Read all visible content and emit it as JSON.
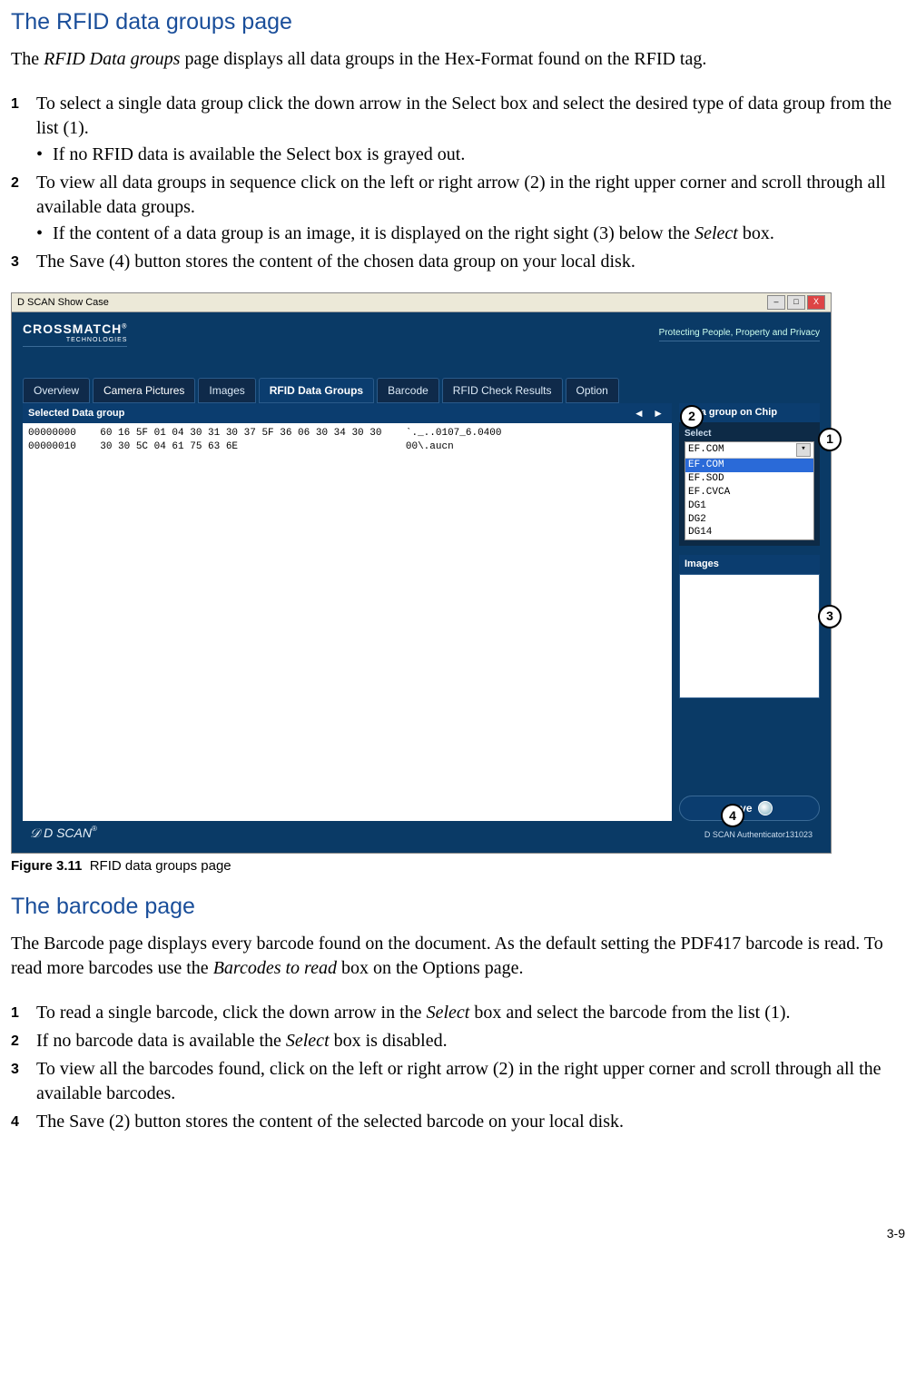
{
  "sections": {
    "rfid": {
      "title": "The RFID data groups page",
      "intro_prefix": "The ",
      "intro_italic": "RFID Data groups",
      "intro_suffix": " page displays all data groups in the Hex-Format found on the RFID tag.",
      "steps": [
        {
          "text": "To select a single data group click the down arrow in the Select box and select the desired type of data group from the list (1).",
          "sub": [
            "If no RFID data is available the Select box is grayed out."
          ]
        },
        {
          "text": "To view all data groups in sequence click on the left or right arrow (2) in the right upper corner and scroll through all available data groups.",
          "sub_rich": {
            "prefix": "If the content of a data group is an image, it is displayed on the right sight (3) below the ",
            "italic": "Select",
            "suffix": " box."
          }
        },
        {
          "text": "The Save (4) button stores the content of the chosen data group on your local disk."
        }
      ]
    },
    "barcode": {
      "title": "The barcode page",
      "intro_prefix": "The Barcode page displays every barcode found on the document. As the default setting the PDF417 barcode is read. To read more barcodes use the ",
      "intro_italic": "Barcodes to read",
      "intro_suffix": " box on the Options page.",
      "steps": [
        {
          "rich": {
            "prefix": "To read a single barcode, click the down arrow in the ",
            "italic": "Select",
            "suffix": " box and select the barcode from the list (1)."
          }
        },
        {
          "rich": {
            "prefix": "If no barcode data is available the ",
            "italic": "Select",
            "suffix": " box is disabled."
          }
        },
        {
          "text": "To view all the barcodes found, click on the left or right arrow (2) in the right upper corner and scroll through all the available barcodes."
        },
        {
          "text": "The Save (2) button stores the content of the selected barcode on your local disk."
        }
      ]
    }
  },
  "figure": {
    "caption_label": "Figure 3.11",
    "caption_text": "RFID data groups page",
    "window_title": "D SCAN Show Case",
    "brand": "CROSSMATCH",
    "brand_sub": "TECHNOLOGIES",
    "tagline": "Protecting People, Property and Privacy",
    "tabs": [
      "Overview",
      "Camera Pictures",
      "Images",
      "RFID Data Groups",
      "Barcode",
      "RFID Check Results",
      "Option"
    ],
    "active_tab_index": 3,
    "left_header": "Selected Data group",
    "arrows": "◄ ►",
    "hex_lines": [
      "00000000    60 16 5F 01 04 30 31 30 37 5F 36 06 30 34 30 30    `._..0107_6.0400",
      "00000010    30 30 5C 04 61 75 63 6E                            00\\.aucn"
    ],
    "right_header": "Data group on Chip",
    "select_label": "Select",
    "select_value": "EF.COM",
    "select_options": [
      "EF.COM",
      "EF.SOD",
      "EF.CVCA",
      "DG1",
      "DG2",
      "DG14"
    ],
    "images_label": "Images",
    "save_label": "Save",
    "footer_brand": "D SCAN",
    "footer_device": "D SCAN Authenticator131023",
    "callouts": {
      "c1": "1",
      "c2": "2",
      "c3": "3",
      "c4": "4"
    }
  },
  "page_number": "3-9"
}
